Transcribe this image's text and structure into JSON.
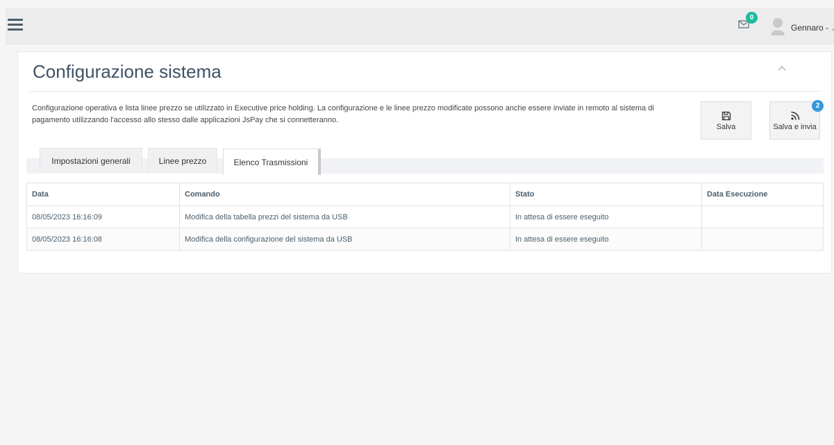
{
  "topbar": {
    "mail_badge": "0",
    "user_name": "Gennaro -",
    "user_caret": "⌄"
  },
  "page": {
    "title": "Configurazione sistema",
    "description": "Configurazione operativa e lista linee prezzo se utilizzato in Executive price holding. La configurazione e le linee prezzo modificate possono anche essere inviate in remoto al sistema di pagamento utilizzando l'accesso allo stesso dalle applicazioni JsPay che si connetteranno."
  },
  "actions": {
    "save_label": "Salva",
    "send_label": "Salva e invia",
    "send_badge": "2"
  },
  "tabs": [
    {
      "label": "Impostazioni generali",
      "active": false
    },
    {
      "label": "Linee prezzo",
      "active": false
    },
    {
      "label": "Elenco Trasmissioni",
      "active": true
    }
  ],
  "table": {
    "headers": [
      "Data",
      "Comando",
      "Stato",
      "Data Esecuzione"
    ],
    "rows": [
      [
        "08/05/2023 16:16:09",
        "Modifica della tabella prezzi del sistema da USB",
        "In attesa di essere eseguito",
        ""
      ],
      [
        "08/05/2023 16:16:08",
        "Modifica della configurazione del sistema da USB",
        "In attesa di essere eseguito",
        ""
      ]
    ]
  },
  "colors": {
    "title": "#3d5266",
    "mail_badge": "#1bbc9b",
    "send_badge": "#3598dc"
  }
}
